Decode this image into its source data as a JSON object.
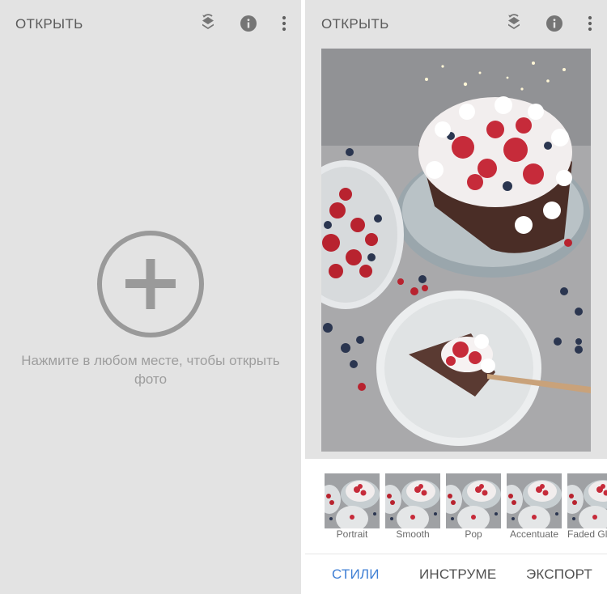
{
  "left_screen": {
    "topbar": {
      "open_label": "ОТКРЫТЬ",
      "icons": [
        "layers-history-icon",
        "info-icon",
        "more-vert-icon"
      ]
    },
    "empty_state": {
      "icon": "add-circle-icon",
      "line1": "Нажмите в любом месте, чтобы открыть",
      "line2": "фото"
    }
  },
  "right_screen": {
    "topbar": {
      "open_label": "ОТКРЫТЬ",
      "icons": [
        "layers-history-icon",
        "info-icon",
        "more-vert-icon"
      ]
    },
    "photo": "cake-with-berries-photo",
    "styles": [
      {
        "label": "Portrait"
      },
      {
        "label": "Smooth"
      },
      {
        "label": "Pop"
      },
      {
        "label": "Accentuate"
      },
      {
        "label": "Faded Glow"
      }
    ],
    "bottom_nav": {
      "styles_tab": "СТИЛИ",
      "tools_tab": "ИНСТРУМЕ",
      "export_tab": "ЭКСПОРТ",
      "active": "styles_tab"
    }
  },
  "colors": {
    "panel_bg": "#e3e3e3",
    "icon_gray": "#757575",
    "accent": "#3f7fd4",
    "plus_gray": "#9a9a9a"
  }
}
